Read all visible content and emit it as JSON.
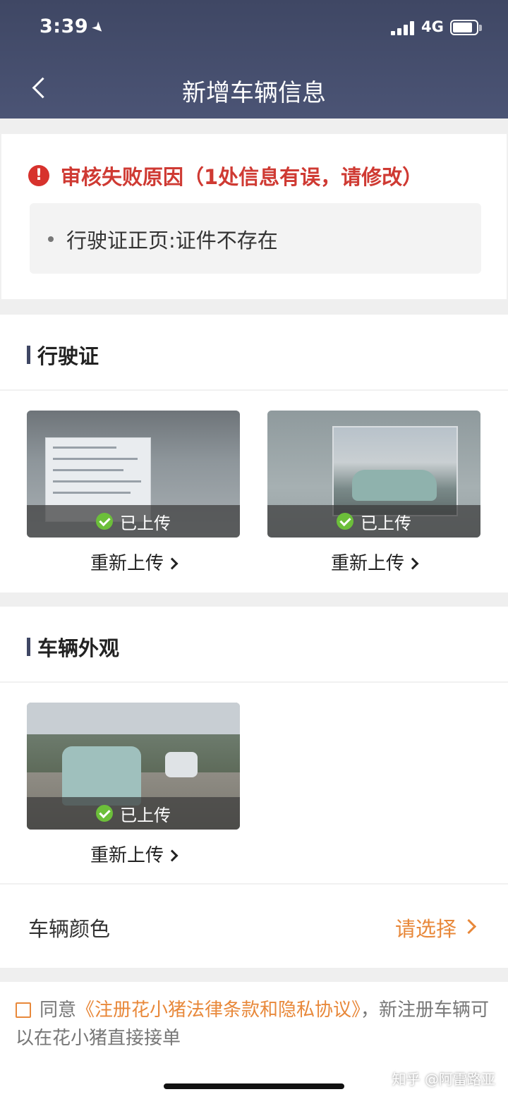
{
  "status_bar": {
    "time": "3:39",
    "network": "4G"
  },
  "nav": {
    "title": "新增车辆信息"
  },
  "error": {
    "title": "审核失败原因（1处信息有误，请修改）",
    "items": [
      "行驶证正页:证件不存在"
    ]
  },
  "license_section": {
    "title": "行驶证",
    "photos": [
      {
        "status": "已上传",
        "action": "重新上传"
      },
      {
        "status": "已上传",
        "action": "重新上传"
      }
    ]
  },
  "exterior_section": {
    "title": "车辆外观",
    "photos": [
      {
        "status": "已上传",
        "action": "重新上传"
      }
    ]
  },
  "color_row": {
    "label": "车辆颜色",
    "value": "请选择"
  },
  "agreement": {
    "prefix": "同意",
    "link": "《注册花小猪法律条款和隐私协议》",
    "suffix": "，新注册车辆可以在花小猪直接接单"
  },
  "watermark": "知乎 @阿雷路亚",
  "colors": {
    "header": "#3f4764",
    "error": "#cf3a33",
    "accent": "#e8883a",
    "check": "#6cbf3a"
  },
  "icons": [
    "back-arrow-icon",
    "location-arrow-icon",
    "signal-icon",
    "battery-icon",
    "error-icon",
    "check-icon",
    "chevron-right-icon"
  ]
}
